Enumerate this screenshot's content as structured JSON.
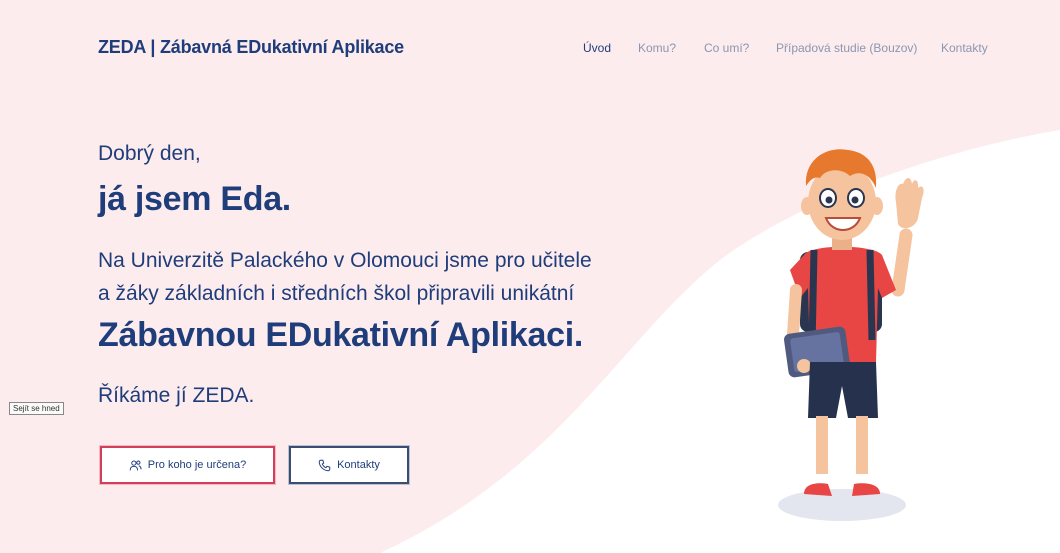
{
  "header": {
    "brand": "ZEDA | Zábavná EDukativní Aplikace",
    "nav": [
      {
        "label": "Úvod",
        "active": true
      },
      {
        "label": "Komu?",
        "active": false
      },
      {
        "label": "Co umí?",
        "active": false
      },
      {
        "label": "Případová studie (Bouzov)",
        "active": false
      },
      {
        "label": "Kontakty",
        "active": false
      }
    ]
  },
  "hero": {
    "greeting": "Dobrý den,",
    "name": "já jsem Eda.",
    "intro_line1": "Na Univerzitě Palackého v Olomouci jsme pro učitele",
    "intro_line2": "a žáky základních i středních škol připravili unikátní",
    "app_name": "Zábavnou EDukativní Aplikaci.",
    "short_name": "Říkáme jí ZEDA."
  },
  "buttons": {
    "primary": {
      "label": "Pro koho je určena?",
      "icon": "users-icon"
    },
    "secondary": {
      "label": "Kontakty",
      "icon": "phone-icon"
    }
  },
  "tooltip": "Sejít se hned",
  "colors": {
    "brand_blue": "#1f3d7a",
    "nav_gray": "#8a97b0",
    "pink_bg": "#fdeced",
    "red_accent": "#d0405a",
    "dark_border": "#3d4d72"
  },
  "illustration": "waving-boy-with-backpack-and-tablet"
}
